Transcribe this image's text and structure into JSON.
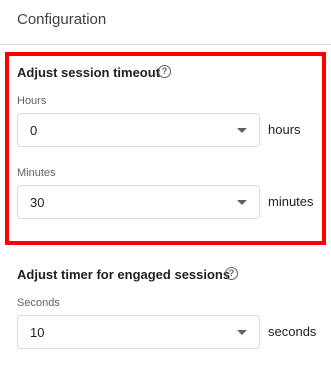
{
  "header": {
    "title": "Configuration"
  },
  "session_timeout": {
    "title": "Adjust session timeout",
    "help_icon": "help-circle-icon",
    "hours": {
      "label": "Hours",
      "value": "0",
      "unit": "hours"
    },
    "minutes": {
      "label": "Minutes",
      "value": "30",
      "unit": "minutes"
    }
  },
  "engaged_sessions": {
    "title": "Adjust timer for engaged sessions",
    "help_icon": "help-circle-icon",
    "seconds": {
      "label": "Seconds",
      "value": "10",
      "unit": "seconds"
    }
  },
  "colors": {
    "highlight": "#ff0000",
    "text": "#202124",
    "muted": "#5f6368",
    "border": "#dadce0"
  }
}
